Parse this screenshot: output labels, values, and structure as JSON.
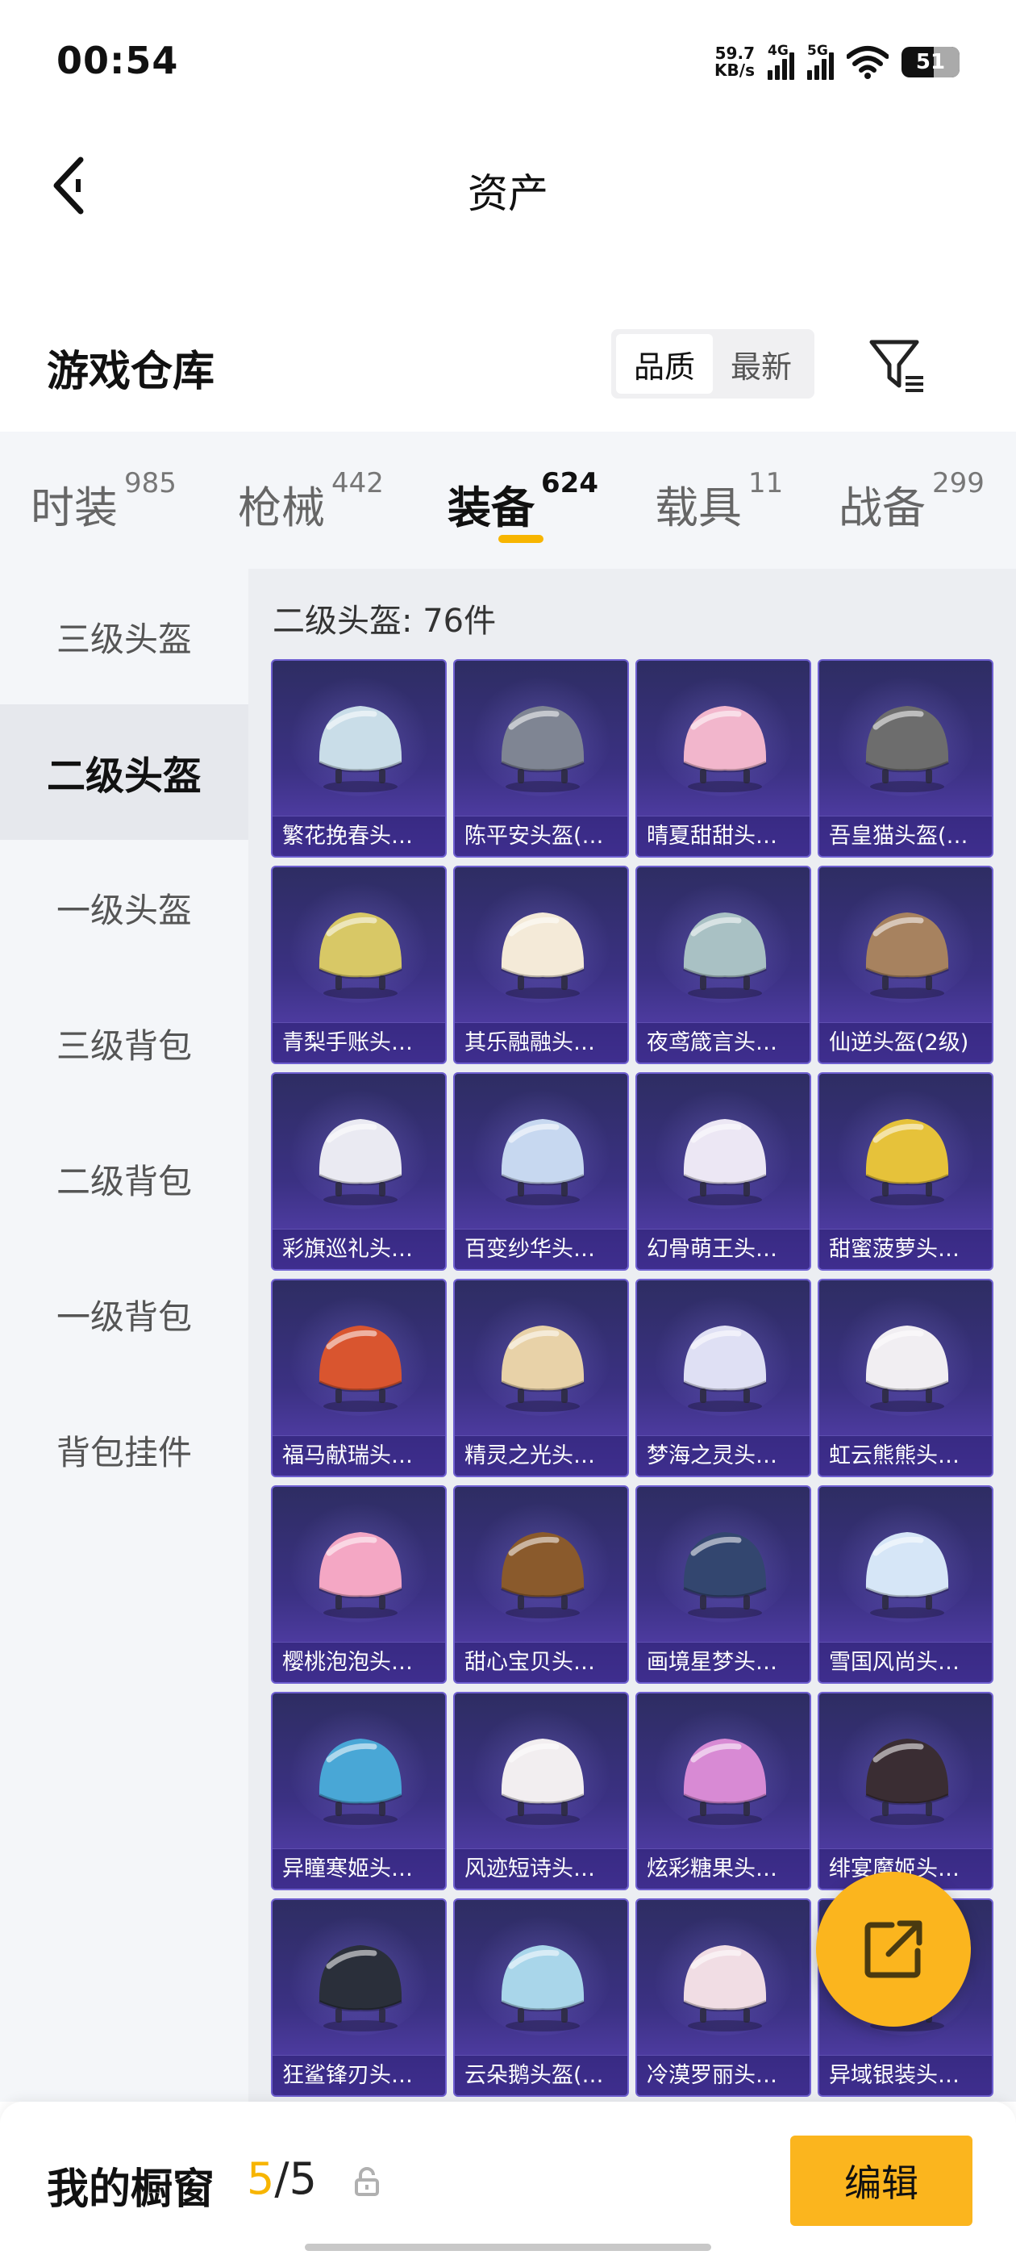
{
  "status_bar": {
    "time": "00:54",
    "net_speed_value": "59.7",
    "net_speed_unit": "KB/s",
    "signal_1_label": "4G",
    "signal_2_label": "5G",
    "battery": "51"
  },
  "header": {
    "title": "资产",
    "back_icon": "chevron-left-icon"
  },
  "warehouse": {
    "title": "游戏仓库",
    "sort_options": [
      "品质",
      "最新"
    ],
    "sort_selected": "品质",
    "filter_icon": "filter-icon"
  },
  "category_tabs": [
    {
      "label": "时装",
      "count": "985",
      "active": false
    },
    {
      "label": "枪械",
      "count": "442",
      "active": false
    },
    {
      "label": "装备",
      "count": "624",
      "active": true
    },
    {
      "label": "载具",
      "count": "11",
      "active": false
    },
    {
      "label": "战备",
      "count": "299",
      "active": false
    }
  ],
  "sidebar": {
    "items": [
      {
        "label": "三级头盔",
        "active": false
      },
      {
        "label": "二级头盔",
        "active": true
      },
      {
        "label": "一级头盔",
        "active": false
      },
      {
        "label": "三级背包",
        "active": false
      },
      {
        "label": "二级背包",
        "active": false
      },
      {
        "label": "一级背包",
        "active": false
      },
      {
        "label": "背包挂件",
        "active": false
      }
    ]
  },
  "content": {
    "count_label": "二级头盔: 76件",
    "items": [
      {
        "name": "繁花挽春头…",
        "color": "#c9dde8"
      },
      {
        "name": "陈平安头盔(…",
        "color": "#7f8593"
      },
      {
        "name": "晴夏甜甜头…",
        "color": "#f2b6cc"
      },
      {
        "name": "吾皇猫头盔(…",
        "color": "#6d6d6d"
      },
      {
        "name": "青梨手账头…",
        "color": "#d8c866"
      },
      {
        "name": "其乐融融头…",
        "color": "#f4ead8"
      },
      {
        "name": "夜鸢箴言头…",
        "color": "#a9c1c4"
      },
      {
        "name": "仙逆头盔(2级)",
        "color": "#a7825f"
      },
      {
        "name": "彩旗巡礼头…",
        "color": "#eaeaf2"
      },
      {
        "name": "百变纱华头…",
        "color": "#c7d8f0"
      },
      {
        "name": "幻骨萌王头…",
        "color": "#ece7f4"
      },
      {
        "name": "甜蜜菠萝头…",
        "color": "#e6c23a"
      },
      {
        "name": "福马献瑞头…",
        "color": "#d9552f"
      },
      {
        "name": "精灵之光头…",
        "color": "#e8d2a8"
      },
      {
        "name": "梦海之灵头…",
        "color": "#dfe0f4"
      },
      {
        "name": "虹云熊熊头…",
        "color": "#f1eef2"
      },
      {
        "name": "樱桃泡泡头…",
        "color": "#f4a7c4"
      },
      {
        "name": "甜心宝贝头…",
        "color": "#8a5a2c"
      },
      {
        "name": "画境星梦头…",
        "color": "#33466f"
      },
      {
        "name": "雪国风尚头…",
        "color": "#d6e6f7"
      },
      {
        "name": "异瞳寒姬头…",
        "color": "#49a7d6"
      },
      {
        "name": "风迹短诗头…",
        "color": "#f2eef0"
      },
      {
        "name": "炫彩糖果头…",
        "color": "#d88ad4"
      },
      {
        "name": "绯宴魔姬头…",
        "color": "#3a2d33"
      },
      {
        "name": "狂鲨锋刃头…",
        "color": "#2a2f3a"
      },
      {
        "name": "云朵鹅头盔(…",
        "color": "#a9d6ea"
      },
      {
        "name": "冷漠罗丽头…",
        "color": "#f1dde4"
      },
      {
        "name": "异域银装头…",
        "color": "#6a6f80"
      }
    ]
  },
  "share_button": {
    "icon": "share-external-icon"
  },
  "bottom_bar": {
    "title": "我的橱窗",
    "current": "5",
    "separator": "/",
    "total": "5",
    "lock_icon": "lock-icon",
    "edit_label": "编辑"
  }
}
